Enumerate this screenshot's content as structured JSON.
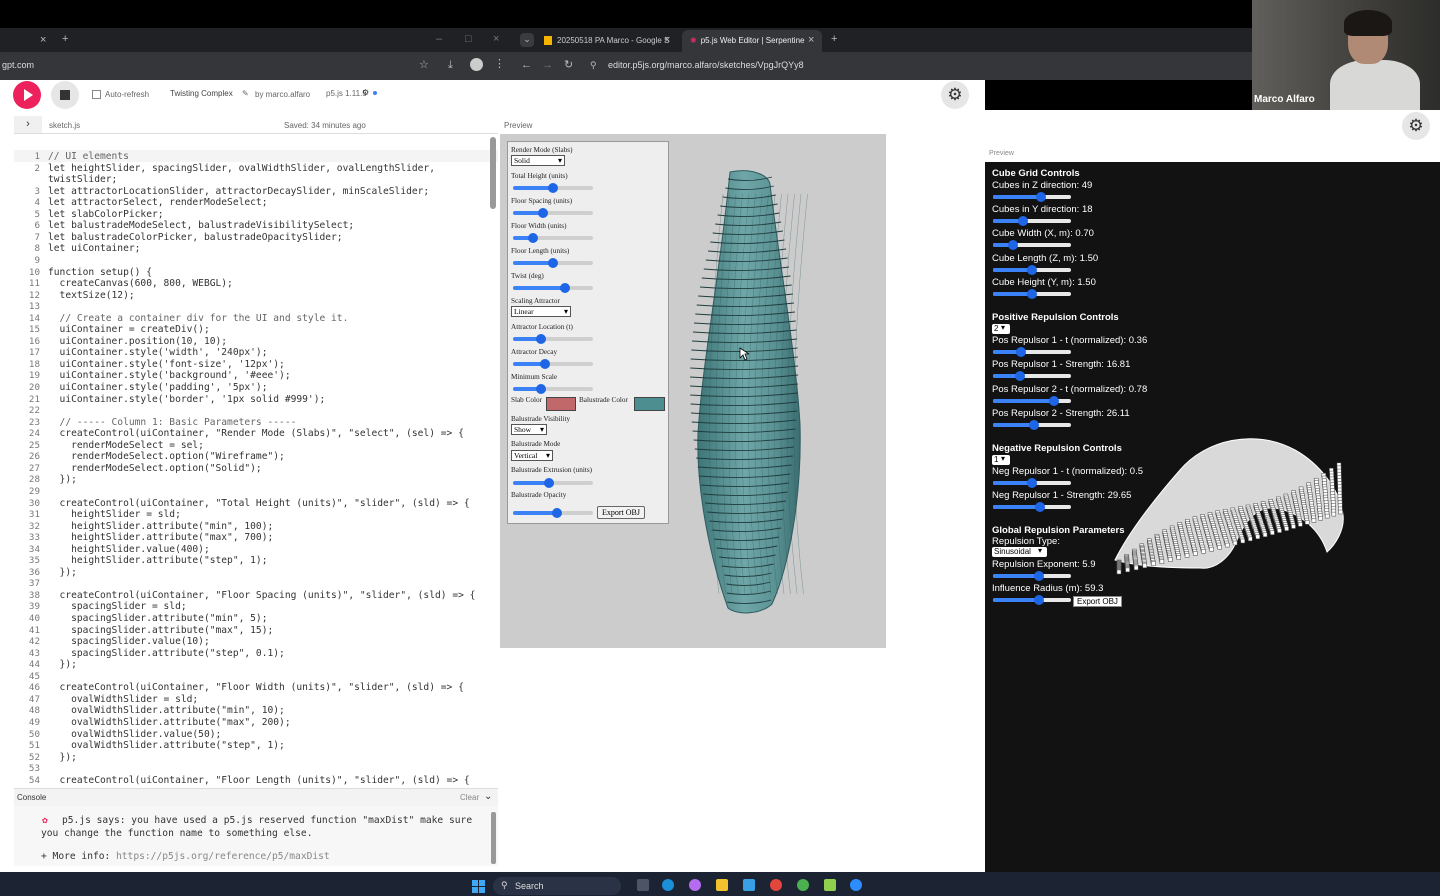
{
  "browser_left": {
    "url": "gpt.com",
    "tab_controls": {
      "close": "×",
      "new": "+"
    }
  },
  "browser_right": {
    "tabs": [
      {
        "label": "20250518 PA Marco - Google S"
      },
      {
        "label": "p5.js Web Editor | Serpentine"
      }
    ],
    "url": "editor.p5js.org/marco.alfaro/sketches/VpgJrQYy8"
  },
  "video": {
    "participant_name": "Marco Alfaro"
  },
  "toolbar": {
    "auto_refresh_label": "Auto-refresh",
    "sketch_title": "Twisting Complex",
    "by_user": "by marco.alfaro",
    "version": "p5.js 1.11.5"
  },
  "editor": {
    "file_name": "sketch.js",
    "saved_status": "Saved: 34 minutes ago",
    "preview_label": "Preview",
    "lines": [
      "// UI elements",
      "let heightSlider, spacingSlider, ovalWidthSlider, ovalLengthSlider,",
      "twistSlider;",
      "let attractorLocationSlider, attractorDecaySlider, minScaleSlider;",
      "let attractorSelect, renderModeSelect;",
      "let slabColorPicker;",
      "let balustradeModeSelect, balustradeVisibilitySelect;",
      "let balustradeColorPicker, balustradeOpacitySlider;",
      "let uiContainer;",
      "",
      "function setup() {",
      "  createCanvas(600, 800, WEBGL);",
      "  textSize(12);",
      "",
      "  // Create a container div for the UI and style it.",
      "  uiContainer = createDiv();",
      "  uiContainer.position(10, 10);",
      "  uiContainer.style('width', '240px');",
      "  uiContainer.style('font-size', '12px');",
      "  uiContainer.style('background', '#eee');",
      "  uiContainer.style('padding', '5px');",
      "  uiContainer.style('border', '1px solid #999');",
      "",
      "  // ----- Column 1: Basic Parameters -----",
      "  createControl(uiContainer, \"Render Mode (Slabs)\", \"select\", (sel) => {",
      "    renderModeSelect = sel;",
      "    renderModeSelect.option(\"Wireframe\");",
      "    renderModeSelect.option(\"Solid\");",
      "  });",
      "",
      "  createControl(uiContainer, \"Total Height (units)\", \"slider\", (sld) => {",
      "    heightSlider = sld;",
      "    heightSlider.attribute(\"min\", 100);",
      "    heightSlider.attribute(\"max\", 700);",
      "    heightSlider.value(400);",
      "    heightSlider.attribute(\"step\", 1);",
      "  });",
      "",
      "  createControl(uiContainer, \"Floor Spacing (units)\", \"slider\", (sld) => {",
      "    spacingSlider = sld;",
      "    spacingSlider.attribute(\"min\", 5);",
      "    spacingSlider.attribute(\"max\", 15);",
      "    spacingSlider.value(10);",
      "    spacingSlider.attribute(\"step\", 0.1);",
      "  });",
      "",
      "  createControl(uiContainer, \"Floor Width (units)\", \"slider\", (sld) => {",
      "    ovalWidthSlider = sld;",
      "    ovalWidthSlider.attribute(\"min\", 10);",
      "    ovalWidthSlider.attribute(\"max\", 200);",
      "    ovalWidthSlider.value(50);",
      "    ovalWidthSlider.attribute(\"step\", 1);",
      "  });",
      "",
      "  createControl(uiContainer, \"Floor Length (units)\", \"slider\", (sld) => {"
    ],
    "line_numbers": [
      "1",
      "2",
      "",
      "3",
      "4",
      "5",
      "6",
      "7",
      "8",
      "9",
      "10",
      "11",
      "12",
      "13",
      "14",
      "15",
      "16",
      "17",
      "18",
      "19",
      "20",
      "21",
      "22",
      "23",
      "24",
      "25",
      "26",
      "27",
      "28",
      "29",
      "30",
      "31",
      "32",
      "33",
      "34",
      "35",
      "36",
      "37",
      "38",
      "39",
      "40",
      "41",
      "42",
      "43",
      "44",
      "45",
      "46",
      "47",
      "48",
      "49",
      "50",
      "51",
      "52",
      "53",
      "54"
    ]
  },
  "console": {
    "label": "Console",
    "clear_label": "Clear",
    "message_line1": "p5.js says: you have used a p5.js reserved function \"maxDist\" make sure",
    "message_line2": "you change the function name to something else.",
    "more_info_label": "+ More info:",
    "more_info_link": "https://p5js.org/reference/p5/maxDist"
  },
  "sketch_controls": {
    "render_mode_label": "Render Mode (Slabs)",
    "render_mode_value": "Solid",
    "sliders": [
      {
        "label": "Total Height (units)",
        "value": 0.5
      },
      {
        "label": "Floor Spacing (units)",
        "value": 0.38
      },
      {
        "label": "Floor Width (units)",
        "value": 0.25
      },
      {
        "label": "Floor Length (units)",
        "value": 0.5
      },
      {
        "label": "Twist (deg)",
        "value": 0.65
      }
    ],
    "scaling_attractor_label": "Scaling Attractor",
    "scaling_attractor_value": "Linear",
    "sliders2": [
      {
        "label": "Attractor Location (t)",
        "value": 0.35
      },
      {
        "label": "Attractor Decay",
        "value": 0.4
      },
      {
        "label": "Minimum Scale",
        "value": 0.35
      }
    ],
    "slab_color_label": "Slab Color",
    "slab_color": "#c0686a",
    "balustrade_color_label": "Balustrade Color",
    "balustrade_color": "#4d8f91",
    "balustrade_visibility_label": "Balustrade Visibility",
    "balustrade_visibility_value": "Show",
    "balustrade_mode_label": "Balustrade Mode",
    "balustrade_mode_value": "Vertical",
    "balustrade_extrusion_label": "Balustrade Extrusion (units)",
    "balustrade_extrusion_value": 0.45,
    "balustrade_opacity_label": "Balustrade Opacity",
    "balustrade_opacity_value": 0.55,
    "export_label": "Export OBJ",
    "tower_color": "#5f9ea0"
  },
  "right_preview": {
    "label": "Preview",
    "sections": {
      "cube_grid_title": "Cube Grid Controls",
      "cube_rows": [
        {
          "label": "Cubes in Z direction: 49",
          "value": 0.62
        },
        {
          "label": "Cubes in Y direction: 18",
          "value": 0.38
        },
        {
          "label": "Cube Width (X, m): 0.70",
          "value": 0.25
        },
        {
          "label": "Cube Length (Z, m): 1.50",
          "value": 0.5
        },
        {
          "label": "Cube Height (Y, m): 1.50",
          "value": 0.5
        }
      ],
      "positive_title": "Positive Repulsion Controls",
      "positive_select": "2",
      "positive_rows": [
        {
          "label": "Pos Repulsor 1 - t (normalized): 0.36",
          "value": 0.36
        },
        {
          "label": "Pos Repulsor 1 - Strength: 16.81",
          "value": 0.34
        },
        {
          "label": "Pos Repulsor 2 - t (normalized): 0.78",
          "value": 0.78
        },
        {
          "label": "Pos Repulsor 2 - Strength: 26.11",
          "value": 0.52
        }
      ],
      "negative_title": "Negative Repulsion Controls",
      "negative_select": "1",
      "negative_rows": [
        {
          "label": "Neg Repulsor 1 - t (normalized): 0.5",
          "value": 0.5
        },
        {
          "label": "Neg Repulsor 1 - Strength: 29.65",
          "value": 0.6
        }
      ],
      "global_title": "Global Repulsion Parameters",
      "repulsion_type_label": "Repulsion Type:",
      "repulsion_type_value": "Sinusoidal",
      "global_rows": [
        {
          "label": "Repulsion Exponent: 5.9",
          "value": 0.59
        },
        {
          "label": "Influence Radius (m): 59.3",
          "value": 0.59
        }
      ],
      "export_label": "Export OBJ"
    }
  },
  "taskbar": {
    "search_label": "Search"
  }
}
